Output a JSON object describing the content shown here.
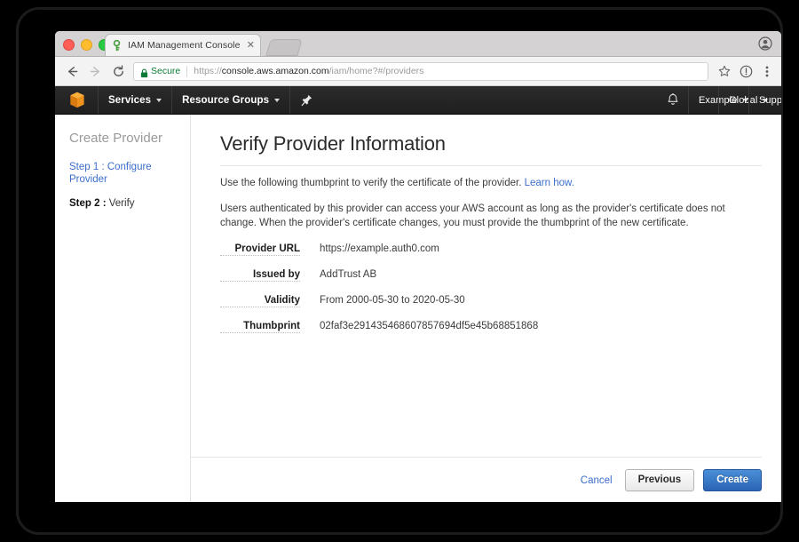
{
  "browser": {
    "tab": {
      "title": "IAM Management Console",
      "favicon_icon": "key-icon",
      "close_icon": "close-icon"
    },
    "newtab_icon": "new-tab-icon",
    "profile_icon": "avatar-icon",
    "toolbar": {
      "back_icon": "arrow-left-icon",
      "forward_icon": "arrow-right-icon",
      "reload_icon": "reload-icon",
      "lock_icon": "lock-icon",
      "secure_label": "Secure",
      "url_scheme": "https://",
      "url_host": "console.aws.amazon.com",
      "url_path": "/iam/home?#/providers",
      "bookmark_icon": "star-icon",
      "info_icon": "exclamation-circle-icon",
      "menu_icon": "three-dots-icon"
    }
  },
  "aws_nav": {
    "logo_icon": "aws-cube-icon",
    "services_label": "Services",
    "resource_groups_label": "Resource Groups",
    "pin_icon": "pin-icon",
    "bell_icon": "bell-icon",
    "account_label": "Example",
    "region_label": "Global",
    "support_label": "Support"
  },
  "sidebar": {
    "title": "Create Provider",
    "step1_label": "Step 1 : Configure Provider",
    "step2_prefix": "Step 2 :",
    "step2_label": "Verify"
  },
  "main": {
    "page_title": "Verify Provider Information",
    "intro_text": "Use the following thumbprint to verify the certificate of the provider.",
    "intro_link": "Learn how.",
    "description": "Users authenticated by this provider can access your AWS account as long as the provider's certificate does not change. When the provider's certificate changes, you must provide the thumbprint of the new certificate.",
    "details": [
      {
        "label": "Provider URL",
        "value": "https://example.auth0.com"
      },
      {
        "label": "Issued by",
        "value": "AddTrust AB"
      },
      {
        "label": "Validity",
        "value": "From 2000-05-30 to 2020-05-30"
      },
      {
        "label": "Thumbprint",
        "value": "02faf3e291435468607857694df5e45b68851868"
      }
    ]
  },
  "footer": {
    "cancel_label": "Cancel",
    "previous_label": "Previous",
    "create_label": "Create"
  },
  "colors": {
    "link": "#3b6ecc",
    "primary_button": "#2a64b4",
    "aws_orange": "#f0921e",
    "secure_green": "#0b7a37",
    "nav_dark": "#232323"
  }
}
